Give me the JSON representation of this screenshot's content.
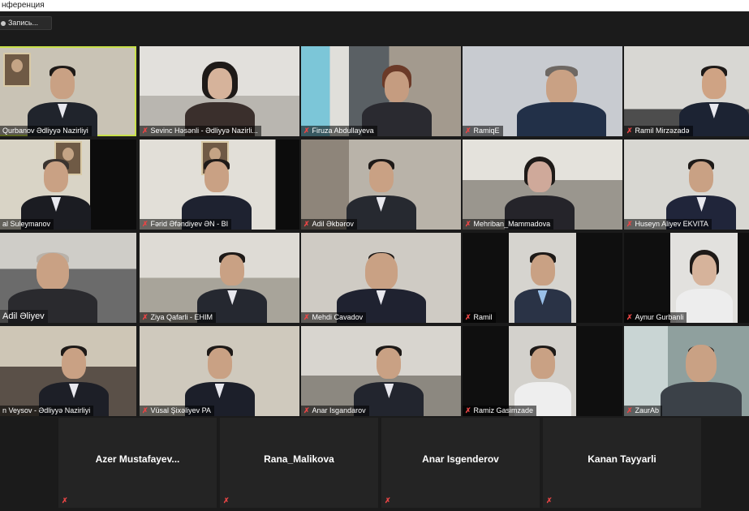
{
  "window": {
    "title": "нференция"
  },
  "recording": {
    "label": "Запись..."
  },
  "participants": [
    "Qurbanov Ədliyyə Nazirliyi",
    "Sevinc Həsənli - Ədliyyə Nazirli...",
    "Firuza Abdullayeva",
    "RamiqE",
    "Ramil Mirzəzadə",
    "al Suleymanov",
    "Fərid Əfəndiyev ƏN - BI",
    "Adil Əkbərov",
    "Mehriban_Mammadova",
    "Huseyn Aliyev EKVITA",
    "Adil Əliyev",
    "Ziya Qafarli - EHIM",
    "Mehdi Cavadov",
    "Ramil",
    "Aynur Gurbanli",
    "n Veysov - Ədliyyə Nazirliyi",
    "Vüsal Şixəliyev PA",
    "Anar Isgandarov",
    "Ramiz Gasimzade",
    "ZaurAb"
  ],
  "audio_only": [
    "Azer  Mustafayev...",
    "Rana_Malikova",
    "Anar Isgenderov",
    "Kanan Tayyarli"
  ],
  "icons": {
    "mic_muted": "mic-muted-icon",
    "record": "record-icon"
  },
  "colors": {
    "active_speaker_border": "#c8e04a",
    "muted_mic": "#e64545",
    "background": "#1b1b1b"
  }
}
